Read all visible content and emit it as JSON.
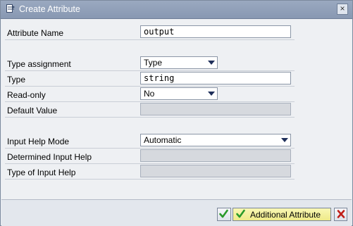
{
  "window": {
    "title": "Create Attribute",
    "close_glyph": "×"
  },
  "fields": {
    "attribute_name": {
      "label": "Attribute Name",
      "value": "output"
    },
    "type_assignment": {
      "label": "Type assignment",
      "value": "Type"
    },
    "type": {
      "label": "Type",
      "value": "string"
    },
    "read_only": {
      "label": "Read-only",
      "value": "No"
    },
    "default_value": {
      "label": "Default Value",
      "value": ""
    },
    "input_help_mode": {
      "label": "Input Help Mode",
      "value": "Automatic"
    },
    "determined_input_help": {
      "label": "Determined Input Help",
      "value": ""
    },
    "type_of_input_help": {
      "label": "Type of Input Help",
      "value": ""
    }
  },
  "buttons": {
    "ok": {
      "icon": "checkmark-icon"
    },
    "additional": {
      "label": "Additional Attribute",
      "icon": "checkmark-icon"
    },
    "cancel": {
      "icon": "cancel-icon"
    }
  },
  "colors": {
    "check_green": "#2a9a2a",
    "cancel_red": "#c0201a",
    "accent": "#f1ee93"
  }
}
